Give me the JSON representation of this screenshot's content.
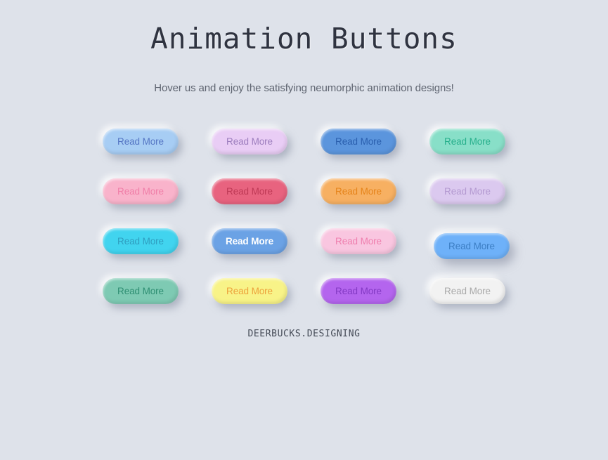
{
  "page": {
    "background_color": "#dee2ea",
    "title": "Animation Buttons",
    "subtitle": "Hover us and enjoy the satisfying neumorphic animation designs!",
    "footer_brand": "DEERBUCKS.DESIGNING"
  },
  "buttons": [
    {
      "label": "Read More",
      "bg": "#a7cdf4",
      "text_color": "#5576c4",
      "bold": false,
      "shifted": false,
      "name": "read-more-button-light-blue"
    },
    {
      "label": "Read More",
      "bg": "#e9cdf5",
      "text_color": "#9d7ebe",
      "bold": false,
      "shifted": false,
      "name": "read-more-button-lavender"
    },
    {
      "label": "Read More",
      "bg": "#5b95dd",
      "text_color": "#2a5fae",
      "bold": false,
      "shifted": false,
      "name": "read-more-button-blue"
    },
    {
      "label": "Read More",
      "bg": "#88dfc8",
      "text_color": "#27b08c",
      "bold": false,
      "shifted": false,
      "name": "read-more-button-mint"
    },
    {
      "label": "Read More",
      "bg": "#f9b3cb",
      "text_color": "#f07fa8",
      "bold": false,
      "shifted": false,
      "name": "read-more-button-pink"
    },
    {
      "label": "Read More",
      "bg": "#e8637f",
      "text_color": "#bf3a56",
      "bold": false,
      "shifted": false,
      "name": "read-more-button-rose"
    },
    {
      "label": "Read More",
      "bg": "#f7b062",
      "text_color": "#e6841b",
      "bold": false,
      "shifted": false,
      "name": "read-more-button-orange"
    },
    {
      "label": "Read More",
      "bg": "#dbc9ef",
      "text_color": "#b49ad1",
      "bold": false,
      "shifted": false,
      "name": "read-more-button-light-lavender"
    },
    {
      "label": "Read More",
      "bg": "#41d4ef",
      "text_color": "#2f9ec0",
      "bold": false,
      "shifted": false,
      "name": "read-more-button-cyan"
    },
    {
      "label": "Read More",
      "bg": "#6ba2e5",
      "text_color": "#ffffff",
      "bold": true,
      "shifted": false,
      "name": "read-more-button-blue-bold"
    },
    {
      "label": "Read More",
      "bg": "#f9c6e0",
      "text_color": "#ef7fae",
      "bold": false,
      "shifted": false,
      "name": "read-more-button-light-pink"
    },
    {
      "label": "Read More",
      "bg": "#6eb1f9",
      "text_color": "#3c7ec4",
      "bold": false,
      "shifted": true,
      "name": "read-more-button-sky-blue-hovered"
    },
    {
      "label": "Read More",
      "bg": "#7ecab3",
      "text_color": "#2f8f73",
      "bold": false,
      "shifted": false,
      "name": "read-more-button-teal"
    },
    {
      "label": "Read More",
      "bg": "#f8f388",
      "text_color": "#eda23c",
      "bold": false,
      "shifted": false,
      "name": "read-more-button-yellow"
    },
    {
      "label": "Read More",
      "bg": "#b465ee",
      "text_color": "#8339c4",
      "bold": false,
      "shifted": false,
      "name": "read-more-button-purple"
    },
    {
      "label": "Read More",
      "bg": "#f2f2f2",
      "text_color": "#a9a9a9",
      "bold": false,
      "shifted": false,
      "name": "read-more-button-white"
    }
  ]
}
